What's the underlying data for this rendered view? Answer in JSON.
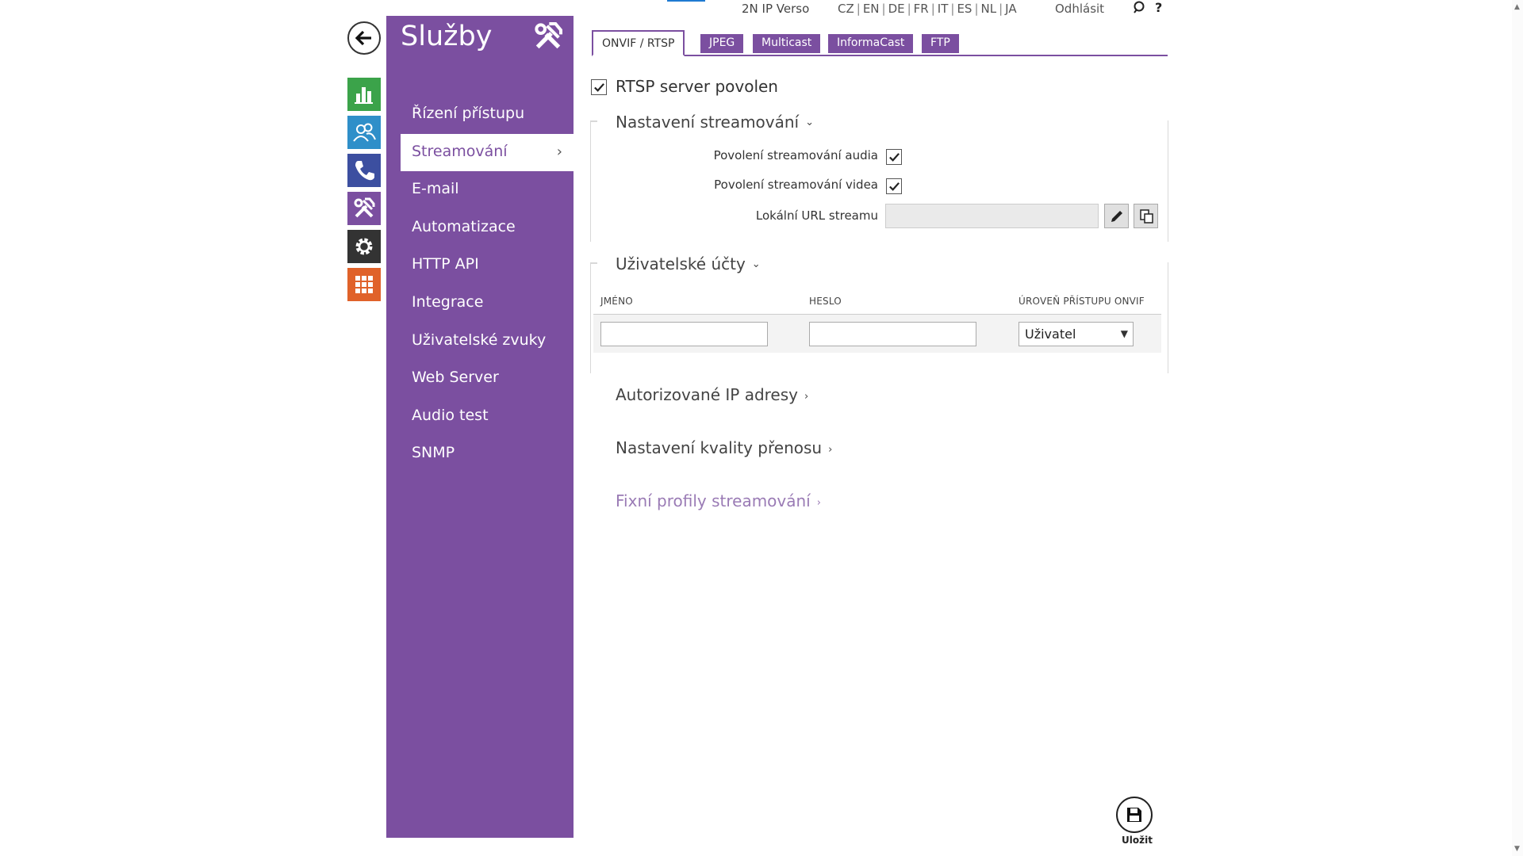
{
  "header": {
    "device_name": "2N IP Verso",
    "languages": [
      "CZ",
      "EN",
      "DE",
      "FR",
      "IT",
      "ES",
      "NL",
      "JA"
    ],
    "logout_label": "Odhlásit",
    "help_label": "?"
  },
  "rail": {
    "items": [
      {
        "icon": "chart-icon",
        "color": "#3ba34a"
      },
      {
        "icon": "users-icon",
        "color": "#2f8fc9"
      },
      {
        "icon": "phone-icon",
        "color": "#3c4fa0"
      },
      {
        "icon": "tools-icon",
        "color": "#7b4fa0"
      },
      {
        "icon": "gear-icon",
        "color": "#333333"
      },
      {
        "icon": "grid-icon",
        "color": "#e0622a"
      }
    ]
  },
  "sidebar": {
    "title": "Služby",
    "items": [
      {
        "label": "Řízení přístupu"
      },
      {
        "label": "Streamování",
        "active": true
      },
      {
        "label": "E-mail"
      },
      {
        "label": "Automatizace"
      },
      {
        "label": "HTTP API"
      },
      {
        "label": "Integrace"
      },
      {
        "label": "Uživatelské zvuky"
      },
      {
        "label": "Web Server"
      },
      {
        "label": "Audio test"
      },
      {
        "label": "SNMP"
      }
    ]
  },
  "tabs": [
    {
      "label": "ONVIF / RTSP",
      "active": true
    },
    {
      "label": "JPEG"
    },
    {
      "label": "Multicast"
    },
    {
      "label": "InformaCast"
    },
    {
      "label": "FTP"
    }
  ],
  "rtsp": {
    "label": "RTSP server povolen",
    "checked": true
  },
  "streaming": {
    "title": "Nastavení streamování",
    "audio_label": "Povolení streamování audia",
    "audio_checked": true,
    "video_label": "Povolení streamování videa",
    "video_checked": true,
    "url_label": "Lokální URL streamu",
    "url_value": ""
  },
  "accounts": {
    "title": "Uživatelské účty",
    "col_name": "JMÉNO",
    "col_password": "HESLO",
    "col_level": "ÚROVEŇ PŘÍSTUPU ONVIF",
    "name_value": "",
    "password_value": "",
    "level_value": "Uživatel"
  },
  "sections": {
    "authorized_ip": "Autorizované IP adresy",
    "quality": "Nastavení kvality přenosu",
    "fixed_profiles": "Fixní profily streamování"
  },
  "save": {
    "label": "Uložit"
  },
  "colors": {
    "accent": "#7b4fa0",
    "link_muted": "#9a7bb5"
  }
}
